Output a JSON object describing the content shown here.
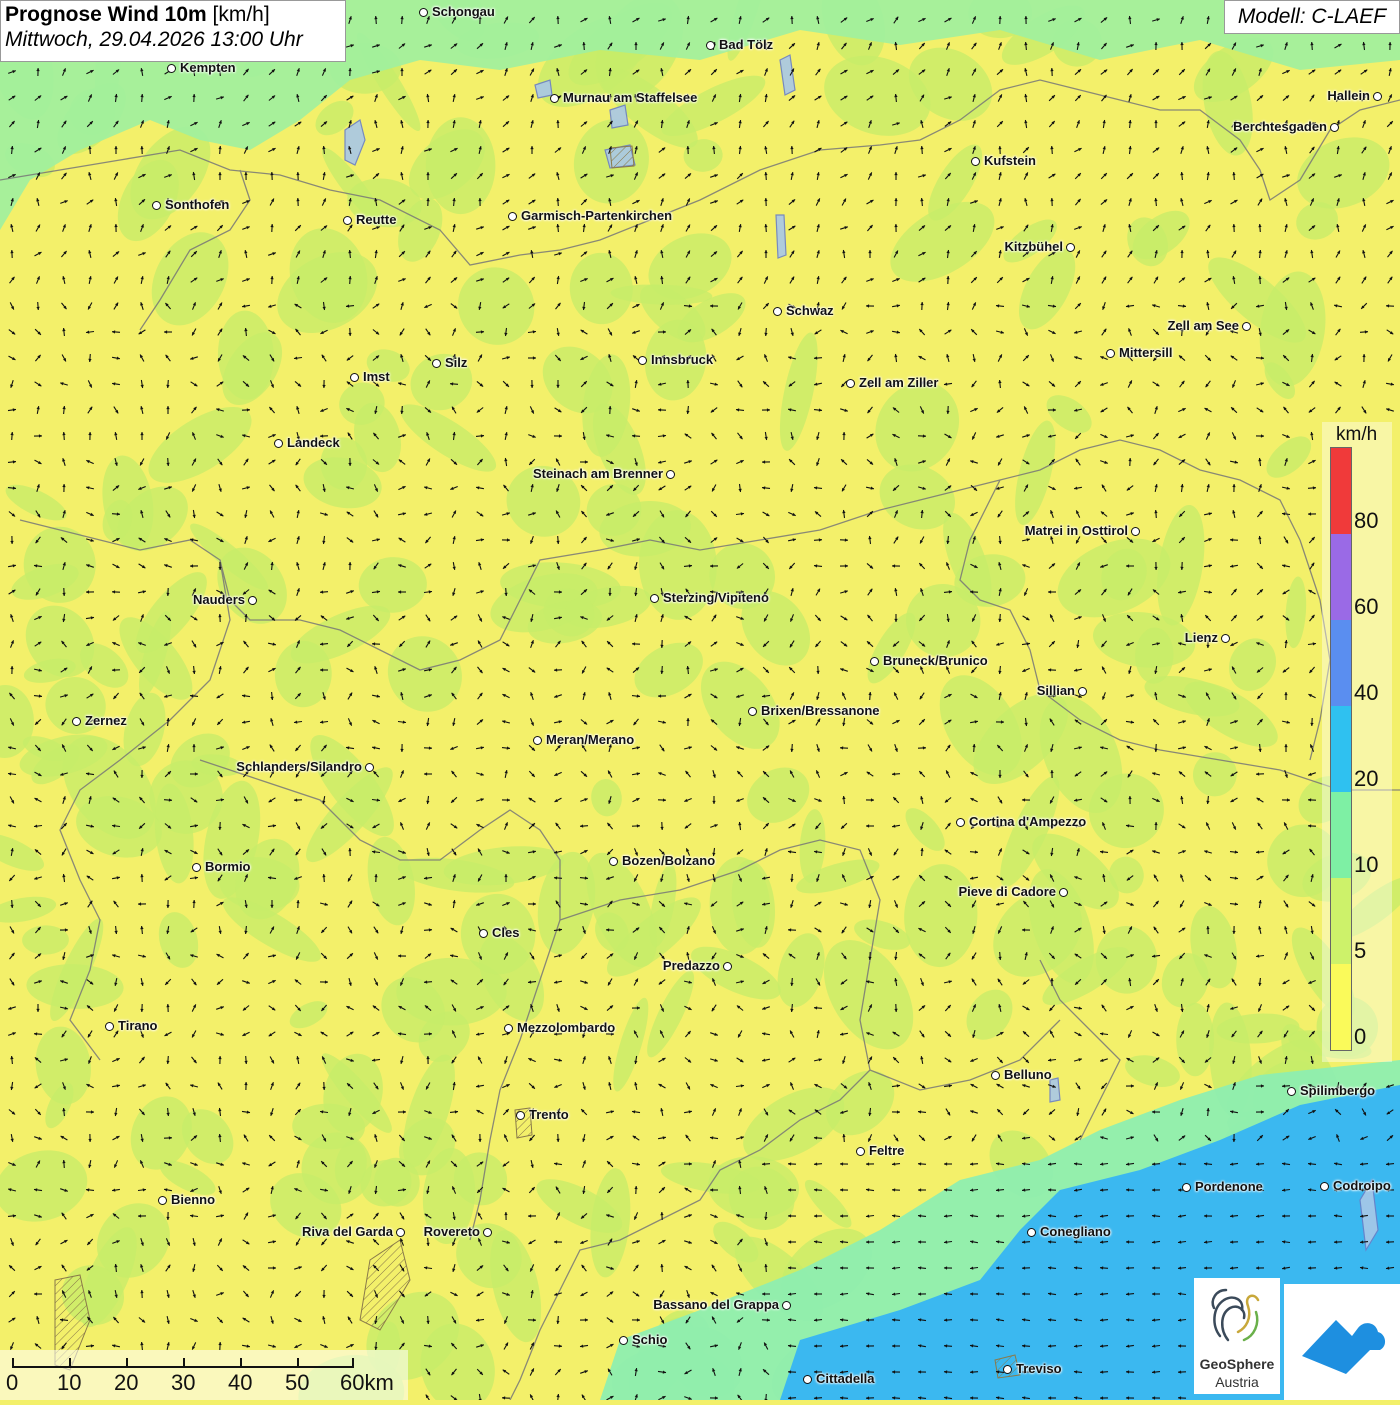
{
  "title": {
    "bold": "Prognose Wind 10m",
    "unit": " [km/h]",
    "datetime": "Mittwoch, 29.04.2026 13:00 Uhr"
  },
  "model": "Modell: C-LAEF",
  "legend": {
    "unit": "km/h",
    "ticks": [
      "80",
      "60",
      "40",
      "20",
      "10",
      "5",
      "0"
    ],
    "colors": [
      "#f03a3a",
      "#9a6ae6",
      "#5a8ef0",
      "#2fc1f0",
      "#7ef0a4",
      "#cdf26a",
      "#fafa5a"
    ]
  },
  "scalebar": {
    "labels": [
      "0",
      "10",
      "20",
      "30",
      "40",
      "50",
      "60km"
    ]
  },
  "logos": {
    "geosphere_line1": "GeoSphere",
    "geosphere_line2": "Austria"
  },
  "cities": [
    {
      "name": "Schongau",
      "side": "r"
    },
    {
      "name": "Kempten",
      "side": "r"
    },
    {
      "name": "Bad Tölz",
      "side": "r"
    },
    {
      "name": "Murnau am Staffelsee",
      "side": "r"
    },
    {
      "name": "Hallein",
      "side": "l"
    },
    {
      "name": "Berchtesgaden",
      "side": "l"
    },
    {
      "name": "Kufstein",
      "side": "r"
    },
    {
      "name": "Sonthofen",
      "side": "r"
    },
    {
      "name": "Reutte",
      "side": "r"
    },
    {
      "name": "Garmisch-Partenkirchen",
      "side": "r"
    },
    {
      "name": "Kitzbühel",
      "side": "l"
    },
    {
      "name": "Schwaz",
      "side": "r"
    },
    {
      "name": "Zell am See",
      "side": "l"
    },
    {
      "name": "Mittersill",
      "side": "r"
    },
    {
      "name": "Innsbruck",
      "side": "r"
    },
    {
      "name": "Silz",
      "side": "r"
    },
    {
      "name": "Imst",
      "side": "r"
    },
    {
      "name": "Zell am Ziller",
      "side": "r"
    },
    {
      "name": "Landeck",
      "side": "r"
    },
    {
      "name": "Steinach am Brenner",
      "side": "l"
    },
    {
      "name": "Matrei in Osttirol",
      "side": "l"
    },
    {
      "name": "Nauders",
      "side": "l"
    },
    {
      "name": "Sterzing/Vipiteno",
      "side": "r"
    },
    {
      "name": "Lienz",
      "side": "l"
    },
    {
      "name": "Bruneck/Brunico",
      "side": "r"
    },
    {
      "name": "Sillian",
      "side": "l"
    },
    {
      "name": "Brixen/Bressanone",
      "side": "r"
    },
    {
      "name": "Zernez",
      "side": "r"
    },
    {
      "name": "Meran/Merano",
      "side": "r"
    },
    {
      "name": "Schlanders/Silandro",
      "side": "l"
    },
    {
      "name": "Cortina d'Ampezzo",
      "side": "r"
    },
    {
      "name": "Bozen/Bolzano",
      "side": "r"
    },
    {
      "name": "Bormio",
      "side": "r"
    },
    {
      "name": "Pieve di Cadore",
      "side": "l"
    },
    {
      "name": "Cles",
      "side": "r"
    },
    {
      "name": "Predazzo",
      "side": "l"
    },
    {
      "name": "Tirano",
      "side": "r"
    },
    {
      "name": "Mezzolombardo",
      "side": "r"
    },
    {
      "name": "Belluno",
      "side": "r"
    },
    {
      "name": "Spilimbergo",
      "side": "r"
    },
    {
      "name": "Trento",
      "side": "r"
    },
    {
      "name": "Feltre",
      "side": "r"
    },
    {
      "name": "Bienno",
      "side": "r"
    },
    {
      "name": "Pordenone",
      "side": "r"
    },
    {
      "name": "Codroipo",
      "side": "r"
    },
    {
      "name": "Riva del Garda",
      "side": "l"
    },
    {
      "name": "Rovereto",
      "side": "l"
    },
    {
      "name": "Conegliano",
      "side": "r"
    },
    {
      "name": "Bassano del Grappa",
      "side": "l"
    },
    {
      "name": "Schio",
      "side": "r"
    },
    {
      "name": "Treviso",
      "side": "r"
    },
    {
      "name": "Cittadella",
      "side": "r"
    }
  ]
}
